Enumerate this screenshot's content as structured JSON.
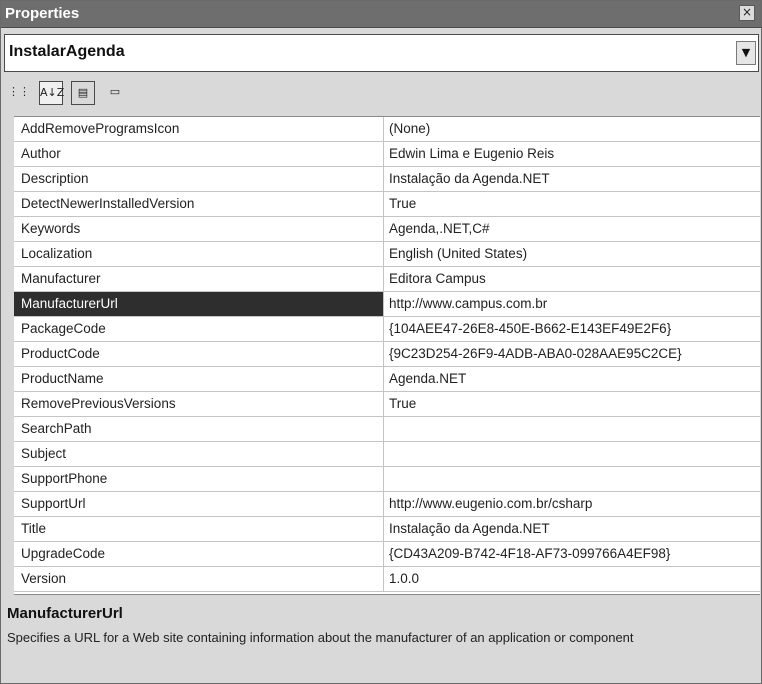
{
  "window": {
    "title": "Properties",
    "close_glyph": "×"
  },
  "object_selector": {
    "value": "InstalarAgenda"
  },
  "toolbar": {
    "buttons": [
      {
        "name": "categorized-icon",
        "glyph": "⋮⋮"
      },
      {
        "name": "alphabetical-icon",
        "glyph": "A↓Z"
      },
      {
        "name": "properties-icon",
        "glyph": "▤"
      },
      {
        "name": "property-pages-icon",
        "glyph": "▭"
      }
    ]
  },
  "grid": {
    "selected_index": 7,
    "rows": [
      {
        "name": "AddRemoveProgramsIcon",
        "value": "(None)"
      },
      {
        "name": "Author",
        "value": "Edwin Lima e Eugenio Reis"
      },
      {
        "name": "Description",
        "value": "Instalação da Agenda.NET"
      },
      {
        "name": "DetectNewerInstalledVersion",
        "value": "True"
      },
      {
        "name": "Keywords",
        "value": "Agenda,.NET,C#"
      },
      {
        "name": "Localization",
        "value": "English (United States)"
      },
      {
        "name": "Manufacturer",
        "value": "Editora Campus"
      },
      {
        "name": "ManufacturerUrl",
        "value": "http://www.campus.com.br"
      },
      {
        "name": "PackageCode",
        "value": "{104AEE47-26E8-450E-B662-E143EF49E2F6}"
      },
      {
        "name": "ProductCode",
        "value": "{9C23D254-26F9-4ADB-ABA0-028AAE95C2CE}"
      },
      {
        "name": "ProductName",
        "value": "Agenda.NET"
      },
      {
        "name": "RemovePreviousVersions",
        "value": "True"
      },
      {
        "name": "SearchPath",
        "value": ""
      },
      {
        "name": "Subject",
        "value": ""
      },
      {
        "name": "SupportPhone",
        "value": ""
      },
      {
        "name": "SupportUrl",
        "value": "http://www.eugenio.com.br/csharp"
      },
      {
        "name": "Title",
        "value": "Instalação da Agenda.NET"
      },
      {
        "name": "UpgradeCode",
        "value": "{CD43A209-B742-4F18-AF73-099766A4EF98}"
      },
      {
        "name": "Version",
        "value": "1.0.0"
      }
    ]
  },
  "description": {
    "title": "ManufacturerUrl",
    "text": "Specifies a URL for a Web site containing information about the manufacturer of an application or component"
  }
}
